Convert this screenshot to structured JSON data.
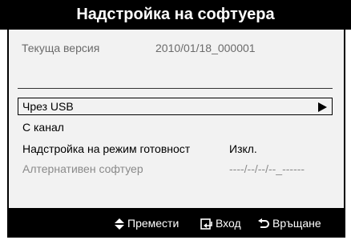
{
  "title": "Надстройка на софтуера",
  "version": {
    "label": "Текуща версия",
    "value": "2010/01/18_000001"
  },
  "menu": {
    "items": [
      {
        "label": "Чрез USB",
        "value": "",
        "icon": "play-arrow-icon"
      },
      {
        "label": "С канал",
        "value": ""
      },
      {
        "label": "Надстройка на режим готовност",
        "value": "Изкл."
      },
      {
        "label": "Алтернативен софтуер",
        "value": "----/--/--/--_------"
      }
    ]
  },
  "footer": {
    "move_label": "Премести",
    "enter_label": "Вход",
    "return_label": "Връщане"
  },
  "colors": {
    "title_bar": "#000000",
    "panel": "#f2f2f2",
    "disabled_text": "#8a8a8a"
  }
}
